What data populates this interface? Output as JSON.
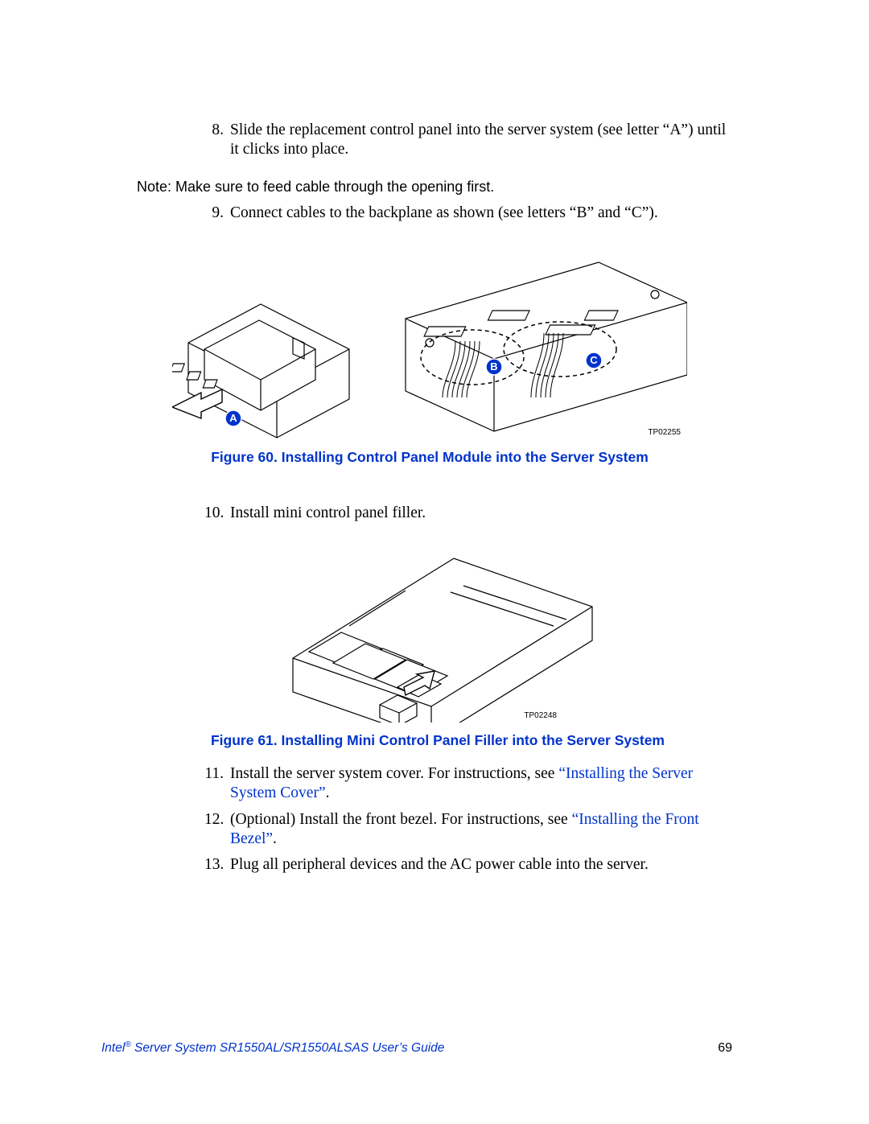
{
  "steps": {
    "s8": {
      "num": "8.",
      "text": "Slide the replacement control panel into the server system (see letter “A”) until it clicks into place."
    },
    "s9": {
      "num": "9.",
      "text": "Connect cables to the backplane as shown (see letters “B” and “C”)."
    },
    "s10": {
      "num": "10.",
      "text": "Install mini control panel filler."
    },
    "s11": {
      "num": "11.",
      "pre": "Install the server system cover. For instructions, see ",
      "link": "“Installing the Server System Cover”",
      "post": "."
    },
    "s12": {
      "num": "12.",
      "pre": "(Optional) Install the front bezel. For instructions, see ",
      "link": "“Installing the Front Bezel”",
      "post": "."
    },
    "s13": {
      "num": "13.",
      "text": "Plug all peripheral devices and the AC power cable into the server."
    }
  },
  "note": "Note:  Make sure to feed cable through the opening first.",
  "figures": {
    "f60": {
      "caption": "Figure 60. Installing Control Panel Module into the Server System",
      "tp": "TP02255",
      "callouts": {
        "A": "A",
        "B": "B",
        "C": "C"
      }
    },
    "f61": {
      "caption": "Figure 61. Installing Mini Control Panel Filler into the Server System",
      "tp": "TP02248"
    }
  },
  "footer": {
    "title_pre": "Intel",
    "title_sup": "®",
    "title_post": " Server System SR1550AL/SR1550ALSAS User’s Guide",
    "page": "69"
  }
}
